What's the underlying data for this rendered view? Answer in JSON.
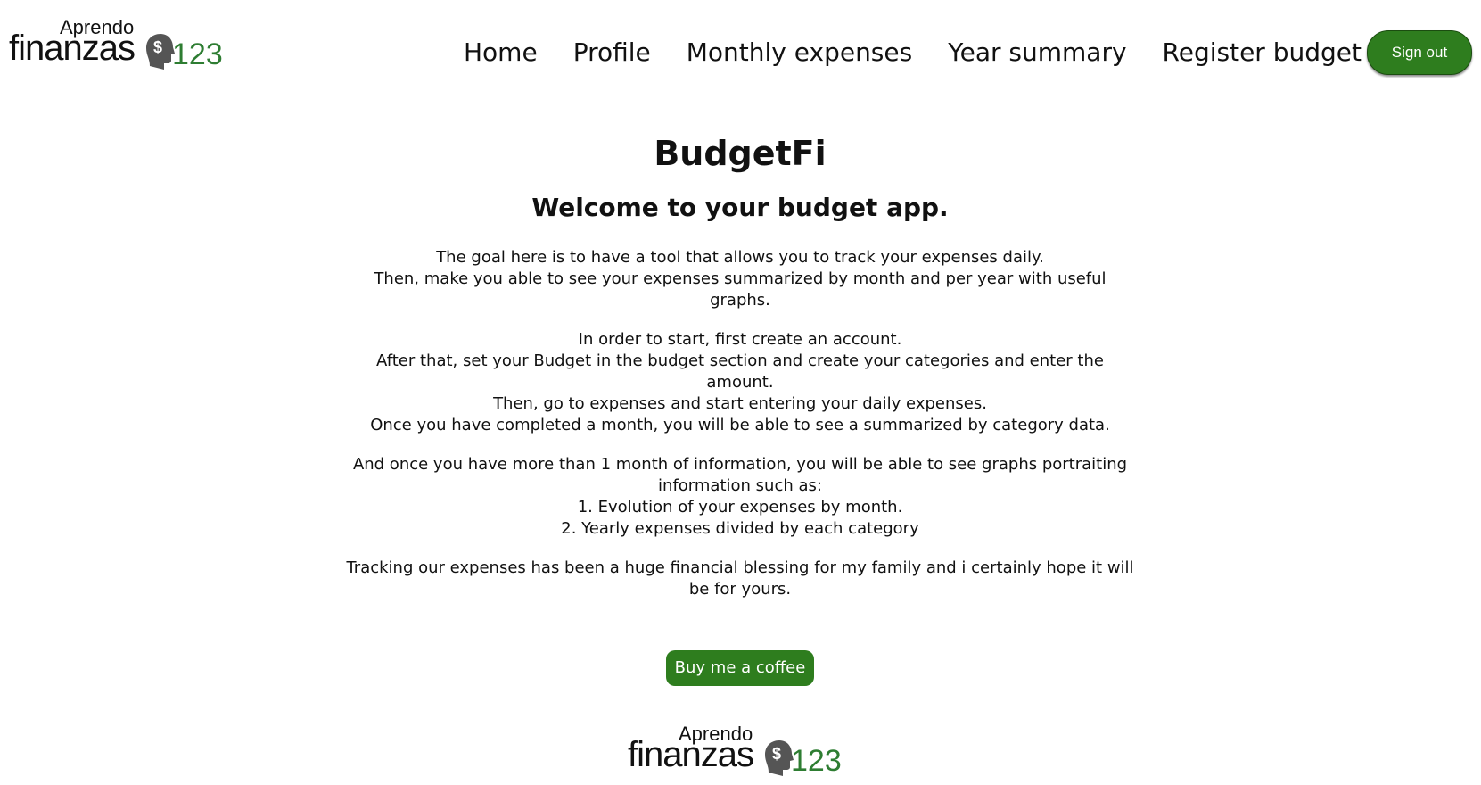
{
  "header": {
    "logo": {
      "small_text": "Aprendo",
      "big_text": "finanzas",
      "number_text": "123",
      "dollar_symbol": "$"
    },
    "nav": [
      {
        "label": "Home"
      },
      {
        "label": "Profile"
      },
      {
        "label": "Monthly expenses"
      },
      {
        "label": "Year summary"
      },
      {
        "label": "Register budget"
      }
    ],
    "signout_label": "Sign out"
  },
  "main": {
    "title": "BudgetFi",
    "subtitle": "Welcome to your budget app.",
    "paragraphs": [
      {
        "lines": [
          "The goal here is to have a tool that allows you to track your expenses daily.",
          "Then, make you able to see your expenses summarized by month and per year with useful",
          "graphs."
        ]
      },
      {
        "lines": [
          "In order to start, first create an account.",
          "After that, set your Budget in the budget section and create your categories and enter the",
          "amount.",
          "Then, go to expenses and start entering your daily expenses.",
          "Once you have completed a month, you will be able to see a summarized by category data."
        ]
      },
      {
        "lines": [
          "And once you have more than 1 month of information, you will be able to see graphs portraiting",
          "information such as:",
          "1. Evolution of your expenses by month.",
          "2. Yearly expenses divided by each category"
        ]
      },
      {
        "lines": [
          "Tracking our expenses has been a huge financial blessing for my family and i certainly hope it will",
          "be for yours."
        ]
      }
    ],
    "coffee_label": "Buy me a coffee"
  },
  "colors": {
    "accent": "#2e7d1e",
    "logo_number": "#2e7d32",
    "text": "#111111",
    "background": "#ffffff"
  },
  "icons": {
    "logo_head": "head-dollar-icon"
  }
}
